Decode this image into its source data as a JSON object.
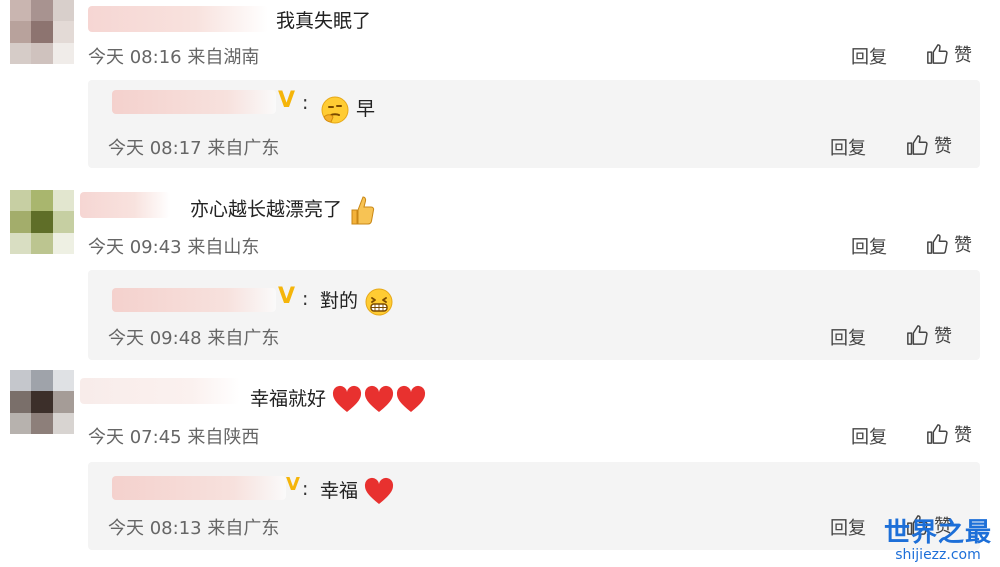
{
  "comments": [
    {
      "text": "我真失眠了",
      "time": "今天 08:16",
      "location": "来自湖南",
      "reply_label": "回复",
      "like_label": "赞",
      "avatar_colors": [
        "#c9b5b0",
        "#a89390",
        "#d8cfcb",
        "#b8a29c",
        "#8d7470",
        "#e3dad6",
        "#d6ccc8",
        "#cfc2be",
        "#f0ece9"
      ],
      "reply": {
        "text": "早",
        "emoji": "thinking-face-emoji",
        "time": "今天 08:17",
        "location": "来自广东",
        "reply_label": "回复",
        "like_label": "赞"
      }
    },
    {
      "text": "亦心越长越漂亮了",
      "emoji": "thumbs-up-emoji",
      "time": "今天 09:43",
      "location": "来自山东",
      "reply_label": "回复",
      "like_label": "赞",
      "avatar_colors": [
        "#c7cfa3",
        "#a9b66e",
        "#e2e6cf",
        "#a3ad6b",
        "#5f6e28",
        "#c6cfa2",
        "#d9dec2",
        "#bcc590",
        "#eef0e3"
      ],
      "reply": {
        "text": "對的",
        "emoji": "grinning-face-emoji",
        "time": "今天 09:48",
        "location": "来自广东",
        "reply_label": "回复",
        "like_label": "赞"
      }
    },
    {
      "text": "幸福就好",
      "emoji": "three-hearts-emoji",
      "time": "今天 07:45",
      "location": "来自陕西",
      "reply_label": "回复",
      "like_label": "赞",
      "avatar_colors": [
        "#c5c7cc",
        "#9fa3aa",
        "#dfe1e4",
        "#7a6f6a",
        "#3c2f2a",
        "#a59c97",
        "#b7b2ae",
        "#8d7f7a",
        "#d8d4d1"
      ],
      "reply": {
        "text": "幸福",
        "emoji": "heart-emoji",
        "time": "今天 08:13",
        "location": "来自广东",
        "reply_label": "回复",
        "like_label": "赞"
      }
    }
  ],
  "watermark": {
    "title": "世界之最",
    "subtitle": "shijiezz.com"
  },
  "colors": {
    "vip_badge": "#f5b50a",
    "heart": "#e8312f",
    "watermark": "#1d6fd8"
  }
}
